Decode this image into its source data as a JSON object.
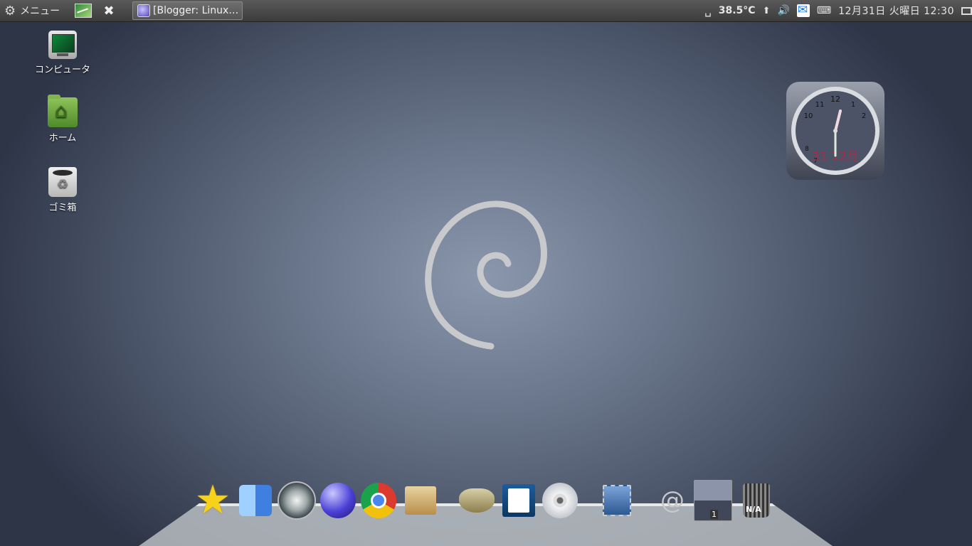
{
  "panel": {
    "menu_label": "メニュー",
    "task_title": "[Blogger: Linux…",
    "temperature": "38.5°C",
    "datetime": "12月31日 火曜日 12:30"
  },
  "desktop": {
    "icons": [
      {
        "label": "コンピュータ"
      },
      {
        "label": "ホーム"
      },
      {
        "label": "ゴミ箱"
      }
    ]
  },
  "clock_widget": {
    "numbers": [
      "12",
      "1",
      "2",
      "10",
      "11",
      "8",
      "7"
    ],
    "date_text": "31 12月",
    "time": "12:30"
  },
  "dock": {
    "workspace_number": "1",
    "trash_label": "N/A",
    "items": [
      "star",
      "finder",
      "time-machine",
      "network",
      "chrome",
      "package",
      "gimp",
      "document",
      "cd",
      "mail",
      "at-mail",
      "workspace",
      "trash"
    ]
  }
}
